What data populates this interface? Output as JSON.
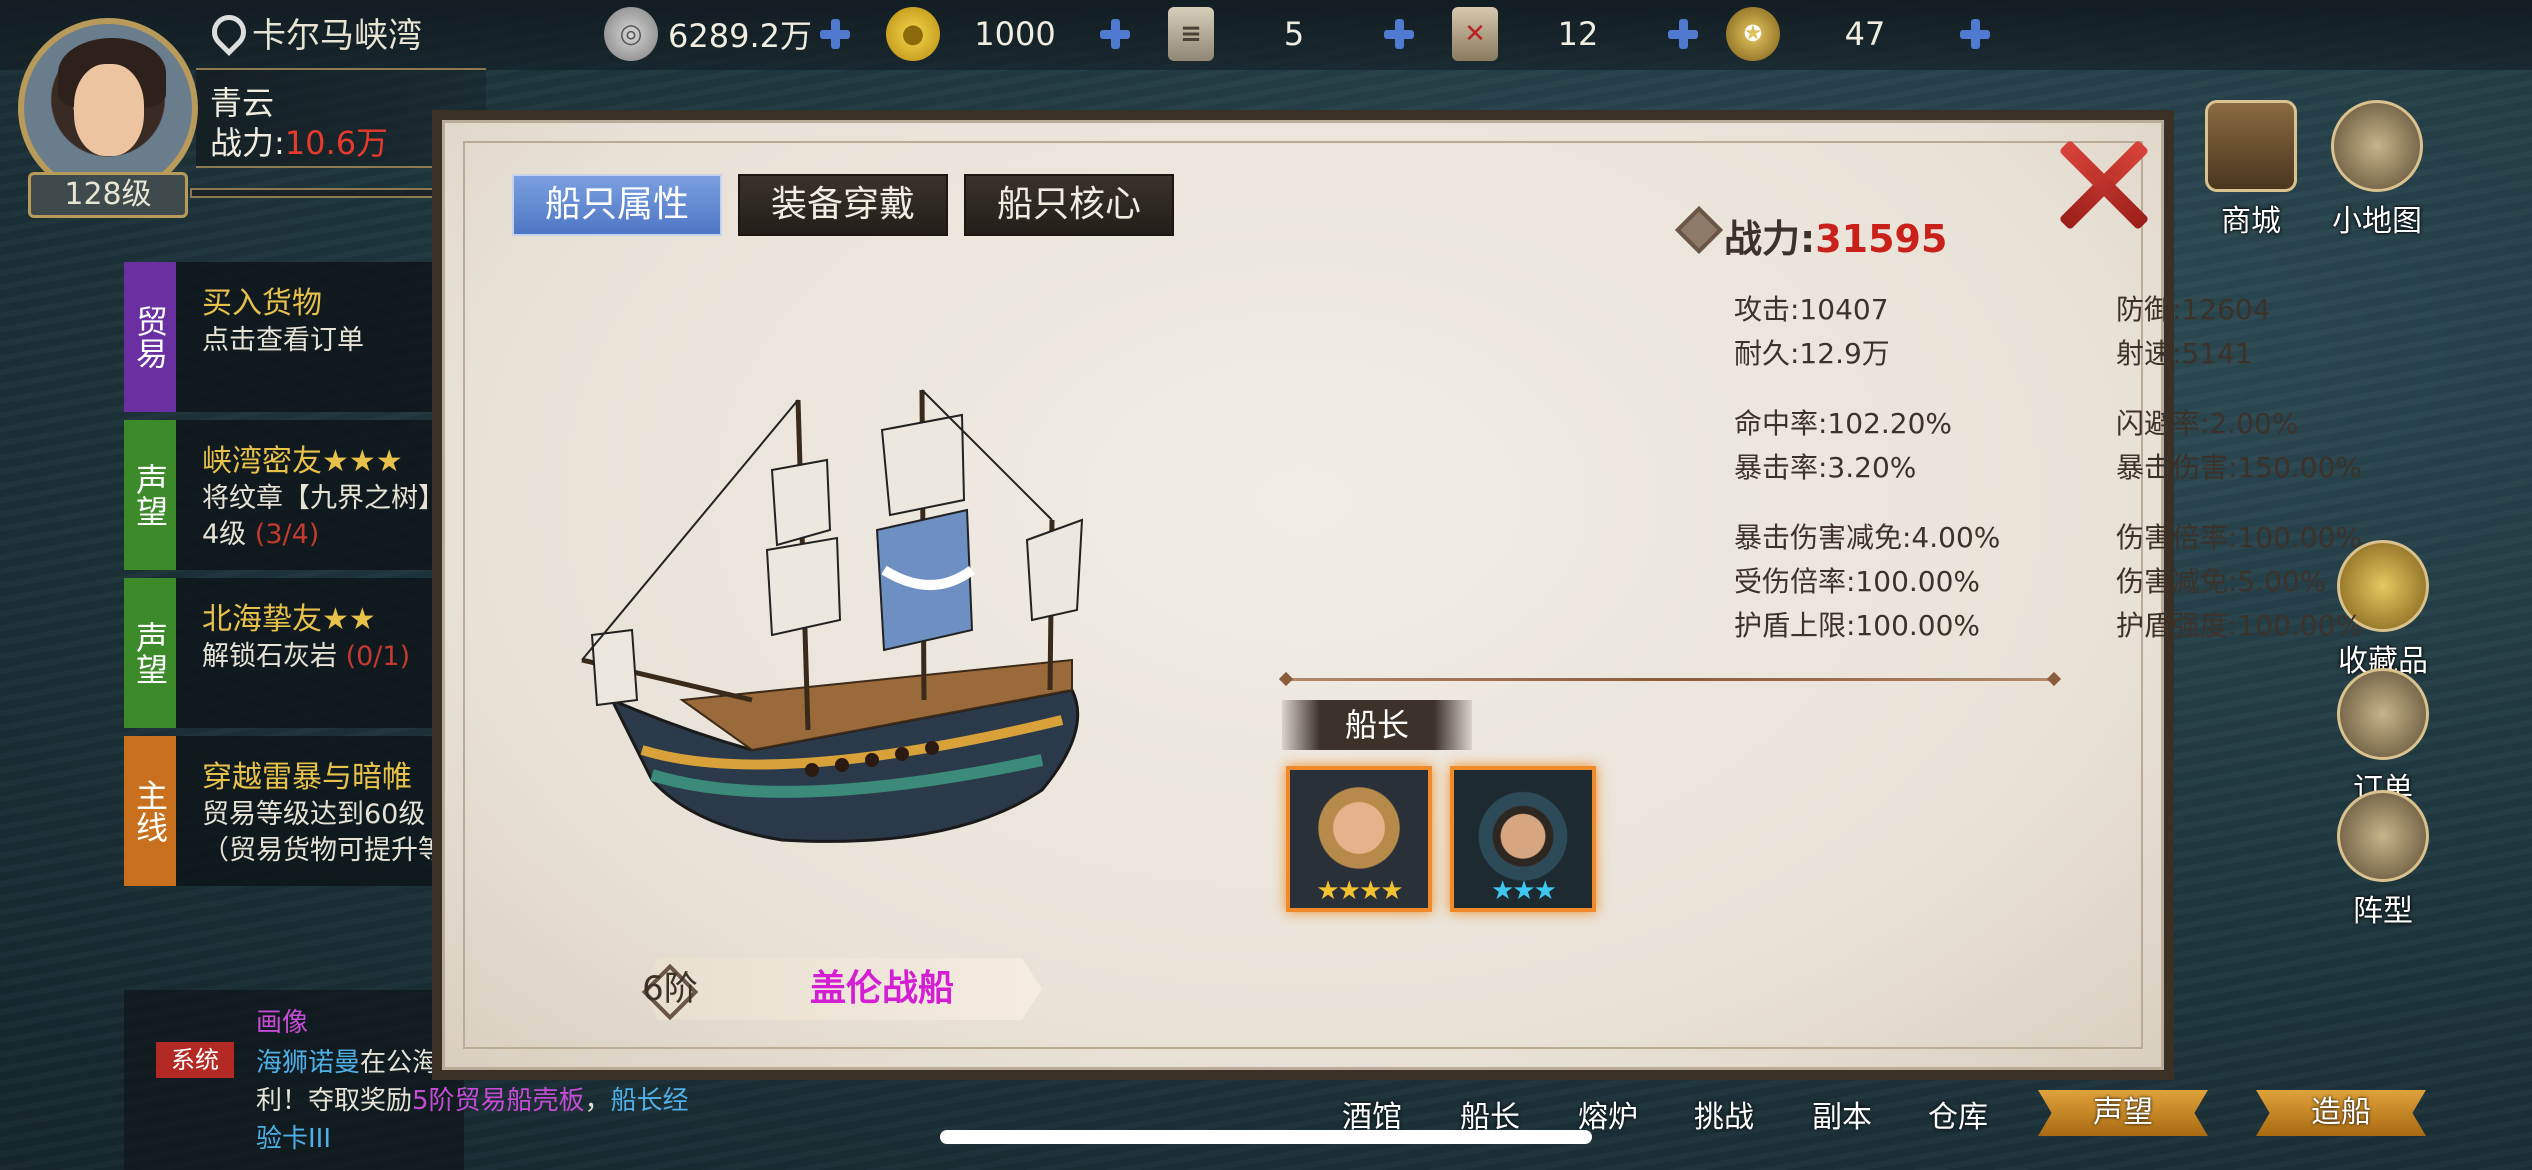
{
  "header": {
    "location": "卡尔马峡湾",
    "resources": [
      {
        "icon": "silver-coin-icon",
        "value": "6289.2万"
      },
      {
        "icon": "gold-coin-icon",
        "value": "1000"
      },
      {
        "icon": "scroll-icon",
        "value": "5"
      },
      {
        "icon": "map-icon",
        "value": "12"
      },
      {
        "icon": "laurel-badge-icon",
        "value": "47"
      }
    ]
  },
  "player": {
    "name": "青云",
    "power_label": "战力:",
    "power_value": "10.6万",
    "level": "128级"
  },
  "quests": [
    {
      "tag": "贸易",
      "tag_color": "#6a2fa0",
      "title": "买入货物",
      "line1": "点击查看订单",
      "line2": "",
      "progress": ""
    },
    {
      "tag": "声望",
      "tag_color": "#3c8a2a",
      "title": "峡湾密友★★★",
      "line1": "将纹章【九界之树】",
      "line2": "4级",
      "progress": "(3/4)"
    },
    {
      "tag": "声望",
      "tag_color": "#3c8a2a",
      "title": "北海挚友★★",
      "line1": "解锁石灰岩",
      "line2": "",
      "progress": "(0/1)"
    },
    {
      "tag": "主线",
      "tag_color": "#c8701e",
      "title": "穿越雷暴与暗帷",
      "line1": "贸易等级达到60级",
      "line2": "（贸易货物可提升等",
      "progress": ""
    }
  ],
  "chat": {
    "portrait": "画像",
    "channel": "系统",
    "line1_name": "海狮诺曼",
    "line1_text": "在公海",
    "line2_a": "利！夺取奖励",
    "line2_item": "5阶贸易船壳板",
    "line2_b": "，",
    "line2_c": "船长经",
    "line3": "验卡III"
  },
  "right_menu": [
    "商城",
    "小地图",
    "收藏品",
    "订单",
    "阵型"
  ],
  "bottom_menu": [
    "酒馆",
    "船长",
    "熔炉",
    "挑战",
    "副本",
    "仓库",
    "声望",
    "造船"
  ],
  "dialog": {
    "tabs": [
      "船只属性",
      "装备穿戴",
      "船只核心"
    ],
    "combat_power_label": "战力:",
    "combat_power": "31595",
    "stats": [
      [
        "攻击:10407",
        "防御:12604"
      ],
      [
        "耐久:12.9万",
        "射速:5141"
      ],
      [
        "命中率:102.20%",
        "闪避率:2.00%"
      ],
      [
        "暴击率:3.20%",
        "暴击伤害:150.00%"
      ],
      [
        "暴击伤害减免:4.00%",
        "伤害倍率:100.00%"
      ],
      [
        "受伤倍率:100.00%",
        "伤害减免:5.00%"
      ],
      [
        "护盾上限:100.00%",
        "护盾强度:100.00%"
      ]
    ],
    "captain_label": "船长",
    "captains": [
      {
        "stars": "★★★★",
        "star_color": "#f1c232",
        "rating": 4
      },
      {
        "stars": "★★★",
        "star_color": "#3ec7f0",
        "rating": 3
      }
    ],
    "ship_grade": "6阶",
    "ship_name": "盖伦战船"
  }
}
